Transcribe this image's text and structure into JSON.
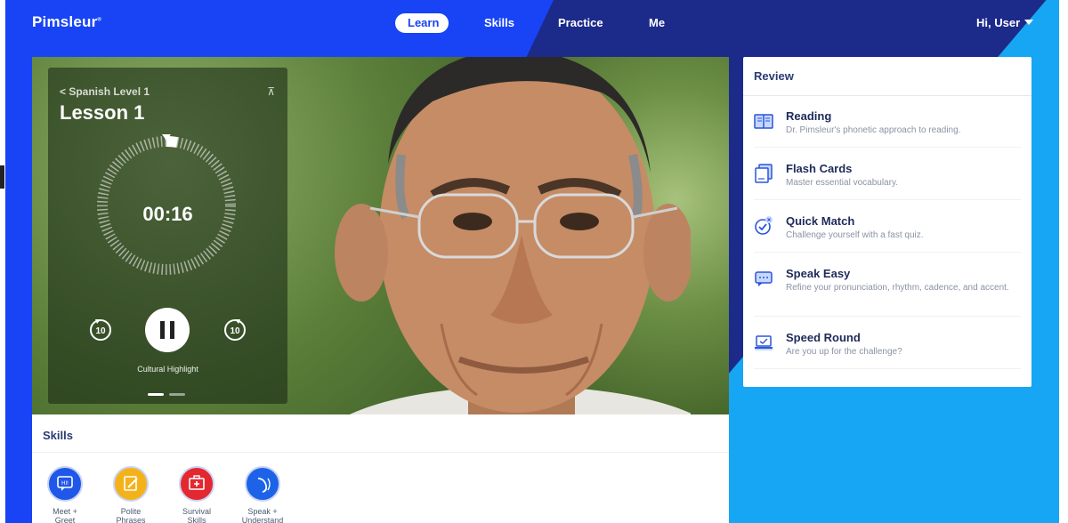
{
  "app": {
    "brand": "Pimsleur"
  },
  "nav": {
    "items": [
      {
        "label": "Learn"
      },
      {
        "label": "Skills"
      },
      {
        "label": "Practice"
      },
      {
        "label": "Me"
      }
    ],
    "user_greeting": "Hi, User"
  },
  "player": {
    "back_label": "Spanish Level 1",
    "lesson_title": "Lesson 1",
    "timer": "00:16",
    "rewind_seconds": "10",
    "forward_seconds": "10",
    "caption": "Cultural Highlight",
    "slide_index": 1,
    "slide_count": 2
  },
  "skills": {
    "title": "Skills",
    "items": [
      {
        "label_line1": "Meet +",
        "label_line2": "Greet",
        "icon": "speech-bubble-hi-icon",
        "color": "#1f57e8"
      },
      {
        "label_line1": "Polite",
        "label_line2": "Phrases",
        "icon": "pencil-note-icon",
        "color": "#f4b21a"
      },
      {
        "label_line1": "Survival",
        "label_line2": "Skills",
        "icon": "first-aid-kit-icon",
        "color": "#e3282f"
      },
      {
        "label_line1": "Speak +",
        "label_line2": "Understand",
        "icon": "ear-sound-icon",
        "color": "#1c63e8"
      }
    ]
  },
  "review": {
    "title": "Review",
    "items": [
      {
        "name": "Reading",
        "description": "Dr. Pimsleur's phonetic approach to reading.",
        "icon": "book-icon"
      },
      {
        "name": "Flash Cards",
        "description": "Master essential vocabulary.",
        "icon": "flash-cards-icon"
      },
      {
        "name": "Quick Match",
        "description": "Challenge yourself with a fast quiz.",
        "icon": "check-circle-icon"
      },
      {
        "name": "Speak Easy",
        "description": "Refine your pronunciation, rhythm, cadence, and accent.",
        "icon": "chat-bubble-icon"
      },
      {
        "name": "Speed Round",
        "description": "Are you up for the challenge?",
        "icon": "laptop-timer-icon"
      }
    ]
  },
  "colors": {
    "brand_blue": "#1844f5",
    "navy": "#1b2a8c",
    "cyan": "#17a6f3"
  }
}
